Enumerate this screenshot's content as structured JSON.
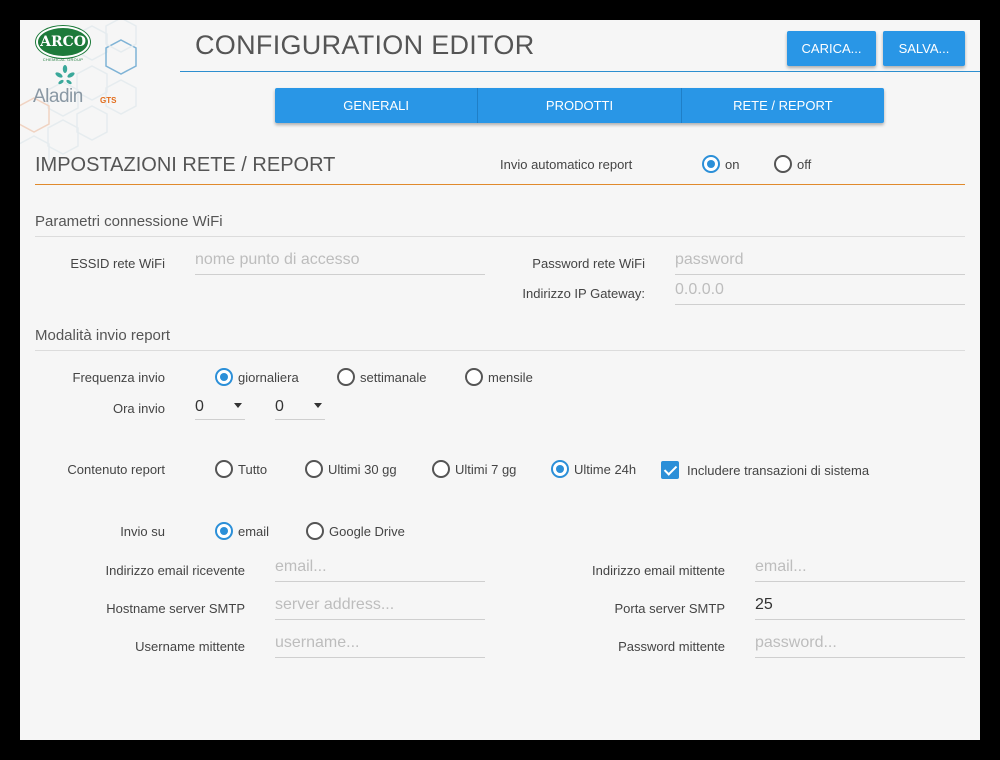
{
  "brand": {
    "arco": "ARCO",
    "arco_sub": "CHEMICAL GROUP",
    "aladin": "Aladin",
    "gts": "GTS",
    "hex_color": "#e9eef0"
  },
  "header": {
    "title": "CONFIGURATION EDITOR",
    "load_label": "CARICA...",
    "save_label": "SALVA..."
  },
  "tabs": [
    {
      "label": "GENERALI"
    },
    {
      "label": "PRODOTTI"
    },
    {
      "label": "RETE / REPORT",
      "active": true
    }
  ],
  "section": {
    "title": "IMPOSTAZIONI RETE / REPORT",
    "auto_report_label": "Invio automatico report",
    "auto_report_on": "on",
    "auto_report_off": "off",
    "auto_report_selected": "on"
  },
  "wifi": {
    "title": "Parametri connessione WiFi",
    "essid_label": "ESSID rete WiFi",
    "essid_placeholder": "nome punto di accesso",
    "password_label": "Password rete WiFi",
    "password_placeholder": "password",
    "gateway_label": "Indirizzo IP Gateway:",
    "gateway_placeholder": "0.0.0.0"
  },
  "report": {
    "title": "Modalità invio report",
    "frequency_label": "Frequenza invio",
    "frequency_options": [
      "giornaliera",
      "settimanale",
      "mensile"
    ],
    "frequency_selected": "giornaliera",
    "time_label": "Ora invio",
    "time_hour": "0",
    "time_minute": "0",
    "content_label": "Contenuto report",
    "content_options": [
      "Tutto",
      "Ultimi 30 gg",
      "Ultimi 7 gg",
      "Ultime 24h"
    ],
    "content_selected": "Ultime 24h",
    "include_system_label": "Includere transazioni di sistema",
    "include_system_checked": true,
    "send_via_label": "Invio su",
    "send_via_options": [
      "email",
      "Google Drive"
    ],
    "send_via_selected": "email"
  },
  "email": {
    "recipient_label": "Indirizzo email ricevente",
    "recipient_placeholder": "email...",
    "sender_label": "Indirizzo email mittente",
    "sender_placeholder": "email...",
    "smtp_host_label": "Hostname server SMTP",
    "smtp_host_placeholder": "server address...",
    "smtp_port_label": "Porta server SMTP",
    "smtp_port_value": "25",
    "username_label": "Username mittente",
    "username_placeholder": "username...",
    "password_label": "Password mittente",
    "password_placeholder": "password..."
  },
  "colors": {
    "accent": "#2996e6",
    "section_line": "#e08a2c",
    "background": "#f6f6f6"
  }
}
